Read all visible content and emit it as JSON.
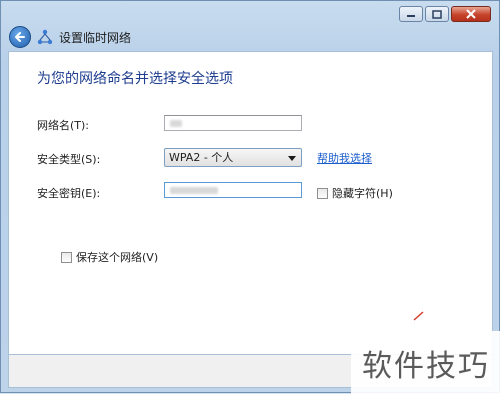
{
  "window": {
    "title": "设置临时网络",
    "caption_buttons": [
      "minimize",
      "maximize",
      "close"
    ]
  },
  "icons": {
    "back": "back-arrow-icon",
    "network": "network-icon",
    "minimize": "minimize-icon",
    "maximize": "maximize-icon",
    "close": "close-icon",
    "dropdown": "chevron-down-icon"
  },
  "content": {
    "heading": "为您的网络命名并选择安全选项",
    "network_name_label": "网络名(T):",
    "security_type_label": "安全类型(S):",
    "security_type_value": "WPA2 - 个人",
    "help_link": "帮助我选择",
    "security_key_label": "安全密钥(E):",
    "hide_chars_label": "隐藏字符(H)",
    "save_network_label": "保存这个网络(V)"
  },
  "watermark": "软件技巧",
  "colors": {
    "heading": "#1e3d8f",
    "link": "#1a5dcc",
    "close_button": "#c6432b"
  }
}
